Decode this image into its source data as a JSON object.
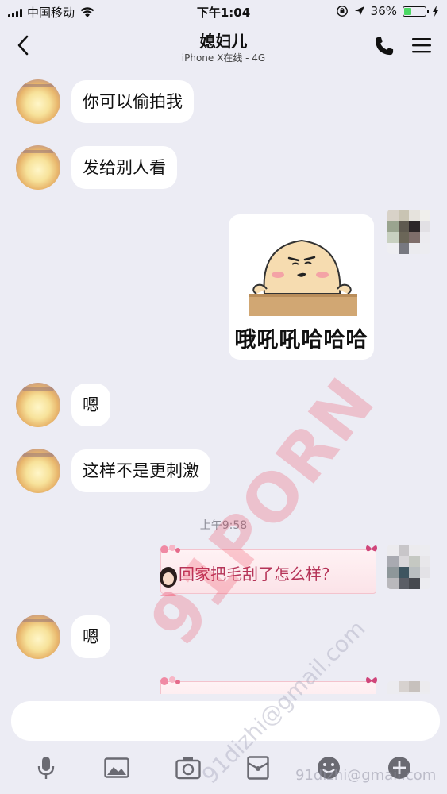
{
  "status_bar": {
    "carrier": "中国移动",
    "time": "下午1:04",
    "battery_percent": "36%",
    "battery_level": 0.36
  },
  "nav": {
    "title": "媳妇儿",
    "subtitle": "iPhone X在线 - 4G"
  },
  "messages": [
    {
      "from": "contact",
      "text": "你可以偷拍我"
    },
    {
      "from": "contact",
      "text": "发给别人看"
    },
    {
      "from": "me",
      "type": "sticker",
      "caption": "哦吼吼哈哈哈"
    },
    {
      "from": "contact",
      "text": "嗯"
    },
    {
      "from": "contact",
      "text": "这样不是更刺激"
    },
    {
      "type": "timestamp",
      "text": "上午9:58"
    },
    {
      "from": "me",
      "type": "theme-bubble",
      "text": "回家把毛刮了怎么样?"
    },
    {
      "from": "contact",
      "text": "嗯"
    },
    {
      "from": "me",
      "type": "theme-bubble",
      "text": ""
    }
  ],
  "toolbar": [
    "microphone-icon",
    "image-icon",
    "camera-icon",
    "red-packet-icon",
    "emoji-icon",
    "plus-icon"
  ],
  "watermark": {
    "main": "91PORN",
    "email": "91dizhi@gmail.com",
    "corner": "91dizhi@gmail.com"
  },
  "colors": {
    "background": "#ececf4",
    "incoming_bubble": "#ffffff",
    "theme_text": "#b53458",
    "watermark": "#eb2846"
  }
}
